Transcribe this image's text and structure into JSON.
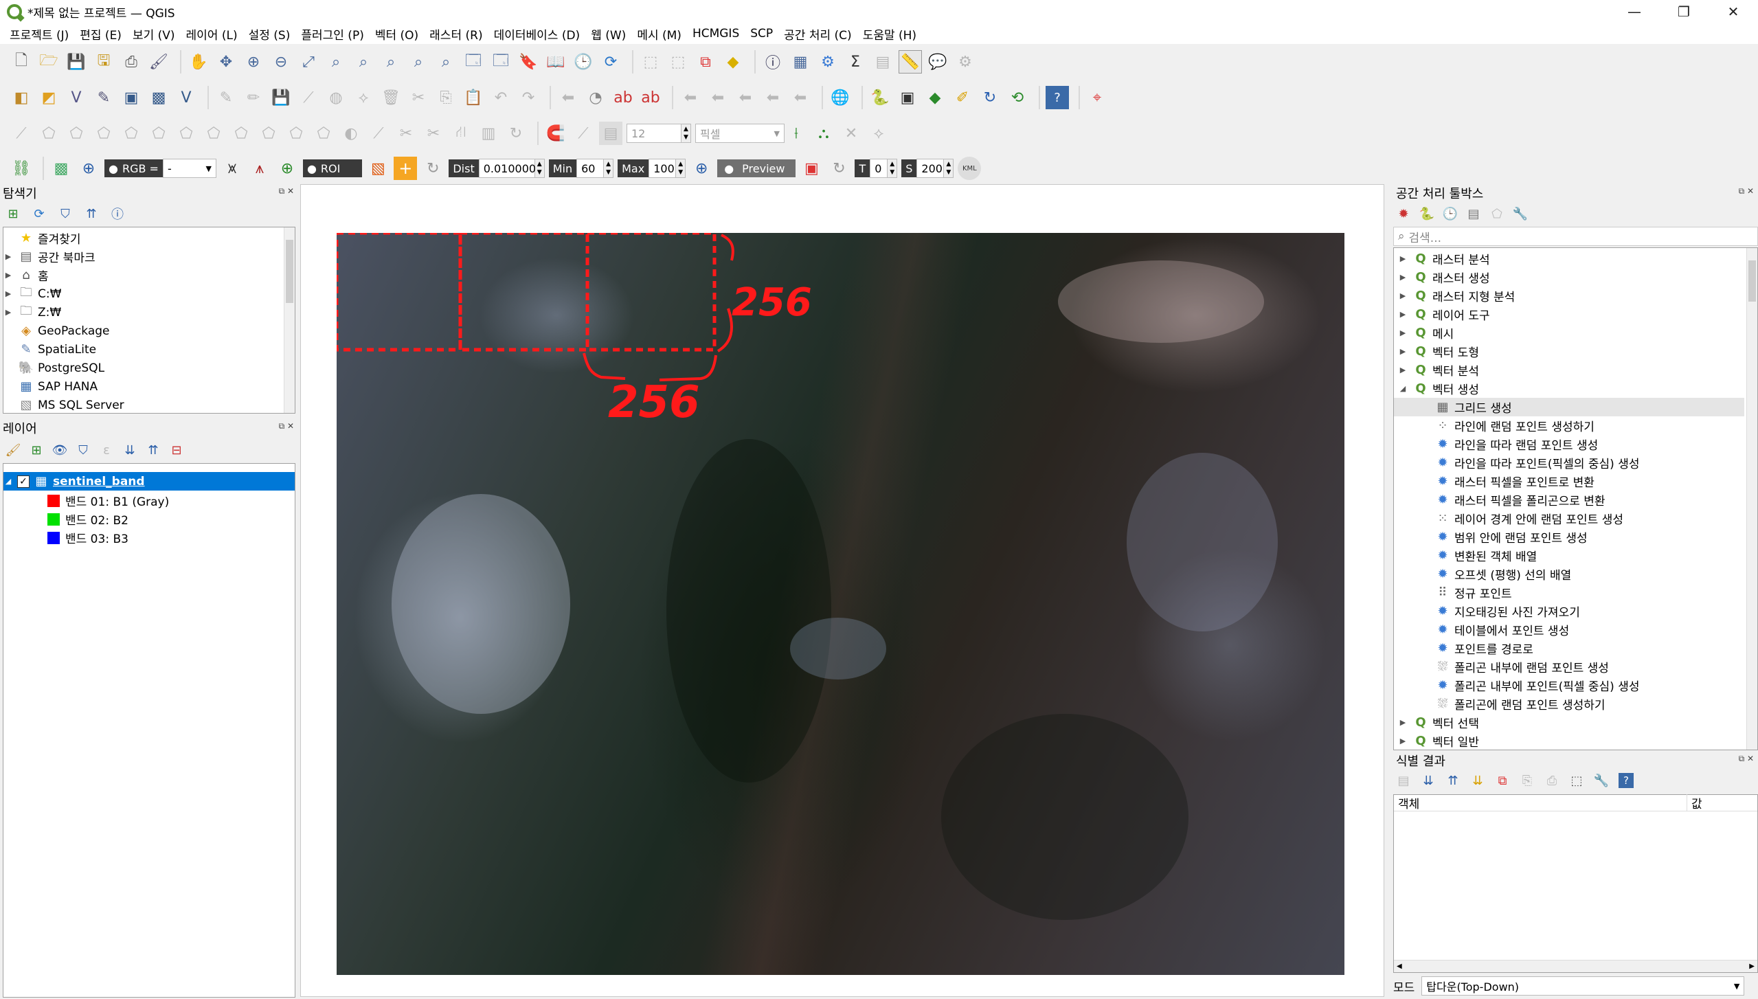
{
  "window": {
    "title": "*제목 없는 프로젝트 — QGIS",
    "controls": [
      "—",
      "❐",
      "✕"
    ]
  },
  "menu": [
    "프로젝트 (J)",
    "편집 (E)",
    "보기 (V)",
    "레이어 (L)",
    "설정 (S)",
    "플러그인 (P)",
    "벡터 (O)",
    "래스터 (R)",
    "데이터베이스 (D)",
    "웹 (W)",
    "메시 (M)",
    "HCMGIS",
    "SCP",
    "공간 처리 (C)",
    "도움말 (H)"
  ],
  "toolbar3": {
    "font_size": "12",
    "unit": "픽셀"
  },
  "scp_toolbar": {
    "rgb_label": "RGB =",
    "rgb_value": "-",
    "roi_label": "ROI",
    "dist_label": "Dist",
    "dist_value": "0.010000",
    "min_label": "Min",
    "min_value": "60",
    "max_label": "Max",
    "max_value": "100",
    "preview_label": "Preview",
    "t_label": "T",
    "t_value": "0",
    "s_label": "S",
    "s_value": "200",
    "kml_label": "KML"
  },
  "browser": {
    "title": "탐색기",
    "items": [
      {
        "label": "즐겨찾기",
        "icon": "star-icon",
        "glyph": "★",
        "color": "#f2c200",
        "expander": ""
      },
      {
        "label": "공간 북마크",
        "icon": "bookmark-icon",
        "glyph": "▤",
        "color": "#666",
        "expander": "▶"
      },
      {
        "label": "홈",
        "icon": "home-folder-icon",
        "glyph": "⌂",
        "color": "#555",
        "expander": "▶"
      },
      {
        "label": "C:₩",
        "icon": "folder-icon",
        "glyph": "🗀",
        "color": "#555",
        "expander": "▶"
      },
      {
        "label": "Z:₩",
        "icon": "folder-icon",
        "glyph": "🗀",
        "color": "#555",
        "expander": "▶"
      },
      {
        "label": "GeoPackage",
        "icon": "geopackage-icon",
        "glyph": "◈",
        "color": "#d48a1f",
        "expander": ""
      },
      {
        "label": "SpatiaLite",
        "icon": "spatialite-icon",
        "glyph": "✎",
        "color": "#5f7fb0",
        "expander": ""
      },
      {
        "label": "PostgreSQL",
        "icon": "postgresql-icon",
        "glyph": "🐘",
        "color": "#33679a",
        "expander": ""
      },
      {
        "label": "SAP HANA",
        "icon": "sap-hana-icon",
        "glyph": "▦",
        "color": "#3a6fb0",
        "expander": ""
      },
      {
        "label": "MS SQL Server",
        "icon": "mssql-icon",
        "glyph": "▧",
        "color": "#888",
        "expander": ""
      }
    ]
  },
  "layers": {
    "title": "레이어",
    "layer_name": "sentinel_band",
    "bands": [
      {
        "label": "밴드 01: B1 (Gray)",
        "color": "#ff0000"
      },
      {
        "label": "밴드 02: B2",
        "color": "#00e000"
      },
      {
        "label": "밴드 03: B3",
        "color": "#0000ff"
      }
    ]
  },
  "map": {
    "annotation_horizontal": "256",
    "annotation_vertical": "256"
  },
  "processing": {
    "title": "공간 처리 툴박스",
    "search_placeholder": "검색...",
    "groups_top": [
      "래스터 분석",
      "래스터 생성",
      "래스터 지형 분석",
      "레이어 도구",
      "메시",
      "벡터 도형",
      "벡터 분석"
    ],
    "expanded_group": "벡터 생성",
    "algorithms": [
      {
        "label": "그리드 생성",
        "icon": "grid-icon",
        "glyph": "▦"
      },
      {
        "label": "라인에 랜덤 포인트 생성하기",
        "icon": "random-points-line-icon",
        "glyph": "⁘"
      },
      {
        "label": "라인을 따라 랜덤 포인트 생성",
        "icon": "gear-icon",
        "glyph": "✹"
      },
      {
        "label": "라인을 따라 포인트(픽셀의 중심) 생성",
        "icon": "gear-icon",
        "glyph": "✹"
      },
      {
        "label": "래스터 픽셀을 포인트로 변환",
        "icon": "gear-icon",
        "glyph": "✹"
      },
      {
        "label": "래스터 픽셀을 폴리곤으로 변환",
        "icon": "gear-icon",
        "glyph": "✹"
      },
      {
        "label": "레이어 경계 안에 랜덤 포인트 생성",
        "icon": "random-points-extent-icon",
        "glyph": "⁙"
      },
      {
        "label": "범위 안에 랜덤 포인트 생성",
        "icon": "gear-icon",
        "glyph": "✹"
      },
      {
        "label": "변환된 객체 배열",
        "icon": "gear-icon",
        "glyph": "✹"
      },
      {
        "label": "오프셋 (평행) 선의 배열",
        "icon": "gear-icon",
        "glyph": "✹"
      },
      {
        "label": "정규 포인트",
        "icon": "regular-points-icon",
        "glyph": "⠿"
      },
      {
        "label": "지오태깅된 사진 가져오기",
        "icon": "gear-icon",
        "glyph": "✹"
      },
      {
        "label": "테이블에서 포인트 생성",
        "icon": "gear-icon",
        "glyph": "✹"
      },
      {
        "label": "포인트를 경로로",
        "icon": "gear-icon",
        "glyph": "✹"
      },
      {
        "label": "폴리곤 내부에 랜덤 포인트 생성",
        "icon": "random-points-polygon-icon",
        "glyph": "⛆"
      },
      {
        "label": "폴리곤 내부에 포인트(픽셀 중심) 생성",
        "icon": "gear-icon",
        "glyph": "✹"
      },
      {
        "label": "폴리곤에 랜덤 포인트 생성하기",
        "icon": "random-points-polygon-icon",
        "glyph": "⛆"
      }
    ],
    "groups_bottom": [
      "벡터 선택",
      "벡터 일반"
    ]
  },
  "identify": {
    "title": "식별 결과",
    "col_feature": "객체",
    "col_value": "값",
    "mode_label": "모드",
    "mode_value": "탑다운(Top-Down)"
  }
}
